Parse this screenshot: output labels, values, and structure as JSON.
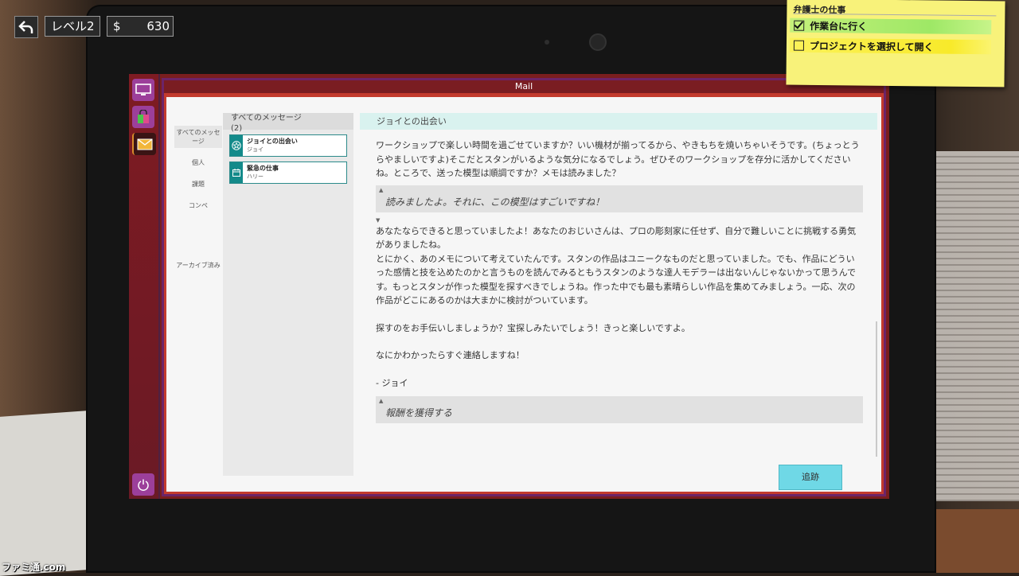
{
  "hud": {
    "back_icon": "back-arrow-icon",
    "level": "レベル2",
    "currency_symbol": "$",
    "money": "630"
  },
  "sticky_note": {
    "title": "弁護士の仕事",
    "tasks": [
      {
        "label": "作業台に行く",
        "checked": true
      },
      {
        "label": "プロジェクトを選択して開く",
        "checked": false
      }
    ]
  },
  "window": {
    "title": "Mail"
  },
  "categories": {
    "all": "すべてのメッセージ",
    "personal": "個人",
    "assignments": "課題",
    "contests": "コンペ",
    "archived": "アーカイブ済み"
  },
  "message_list": {
    "header": "すべてのメッセージ",
    "count": "(2)",
    "items": [
      {
        "subject": "ジョイとの出会い",
        "sender": "ジョイ",
        "icon": "star-icon"
      },
      {
        "subject": "緊急の仕事",
        "sender": "ハリー",
        "icon": "calendar-icon"
      }
    ]
  },
  "message": {
    "title": "ジョイとの出会い",
    "paragraph_1": "ワークショップで楽しい時間を過ごせていますか？いい機材が揃ってるから、やきもちを焼いちゃいそうです。(ちょっとうらやましいですよ)そこだとスタンがいるような気分になるでしょう。ぜひそのワークショップを存分に活かしてくださいね。ところで、送った模型は順調ですか？メモは読みました？",
    "reply_1": "読みましたよ。それに、この模型はすごいですね！",
    "paragraph_2": "あなたならできると思っていましたよ！あなたのおじいさんは、プロの彫刻家に任せず、自分で難しいことに挑戦する勇気がありましたね。",
    "paragraph_3": "とにかく、あのメモについて考えていたんです。スタンの作品はユニークなものだと思っていました。でも、作品にどういった感情と技を込めたのかと言うものを読んでみるともうスタンのような達人モデラーは出ないんじゃないかって思うんです。もっとスタンが作った模型を探すべきでしょうね。作った中でも最も素晴らしい作品を集めてみましょう。一応、次の作品がどこにあるのかは大まかに検討がついています。",
    "paragraph_4": "探すのをお手伝いしましょうか？宝探しみたいでしょう！きっと楽しいですよ。",
    "paragraph_5": "なにかわかったらすぐ連絡しますね！",
    "signature": "- ジョイ",
    "reply_2": "報酬を獲得する",
    "collapse_arrow": "▲",
    "expand_arrow": "▼",
    "track_button": "追跡"
  },
  "watermark": "ファミ通.com",
  "colors": {
    "accent_teal": "#138a8a",
    "track_button": "#6fd8e6",
    "window_frame": "#6c2468",
    "sticky_note": "#f8f27a"
  }
}
